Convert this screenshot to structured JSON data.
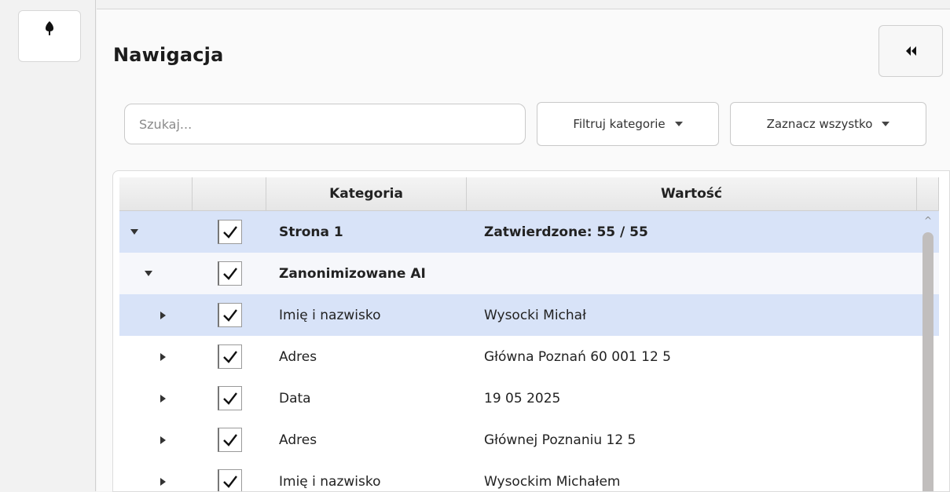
{
  "sidebar": {
    "tree_button_icon": "tree-icon"
  },
  "panel": {
    "title": "Nawigacja",
    "collapse_icon": "double-chevron-left-icon"
  },
  "toolbar": {
    "search_placeholder": "Szukaj...",
    "filter_label": "Filtruj kategorie",
    "select_label": "Zaznacz wszystko"
  },
  "table": {
    "headers": [
      "",
      "",
      "Kategoria",
      "Wartość"
    ],
    "rows": [
      {
        "level": 0,
        "expanded": true,
        "checked": true,
        "category": "Strona 1",
        "value": "Zatwierdzone: 55 / 55",
        "bold": true
      },
      {
        "level": 1,
        "expanded": true,
        "checked": true,
        "category": "Zanonimizowane AI",
        "value": "",
        "bold": true
      },
      {
        "level": 2,
        "expanded": false,
        "checked": true,
        "category": "Imię i nazwisko",
        "value": "Wysocki Michał",
        "bold": false
      },
      {
        "level": 2,
        "expanded": false,
        "checked": true,
        "category": "Adres",
        "value": "Główna Poznań 60 001 12 5",
        "bold": false
      },
      {
        "level": 2,
        "expanded": false,
        "checked": true,
        "category": "Data",
        "value": "19 05 2025",
        "bold": false
      },
      {
        "level": 2,
        "expanded": false,
        "checked": true,
        "category": "Adres",
        "value": "Głównej Poznaniu 12 5",
        "bold": false
      },
      {
        "level": 2,
        "expanded": false,
        "checked": true,
        "category": "Imię i nazwisko",
        "value": "Wysockim Michałem",
        "bold": false
      }
    ]
  },
  "colors": {
    "selected_row": "#d8e3f8",
    "scroll_thumb": "#c1bebd"
  }
}
